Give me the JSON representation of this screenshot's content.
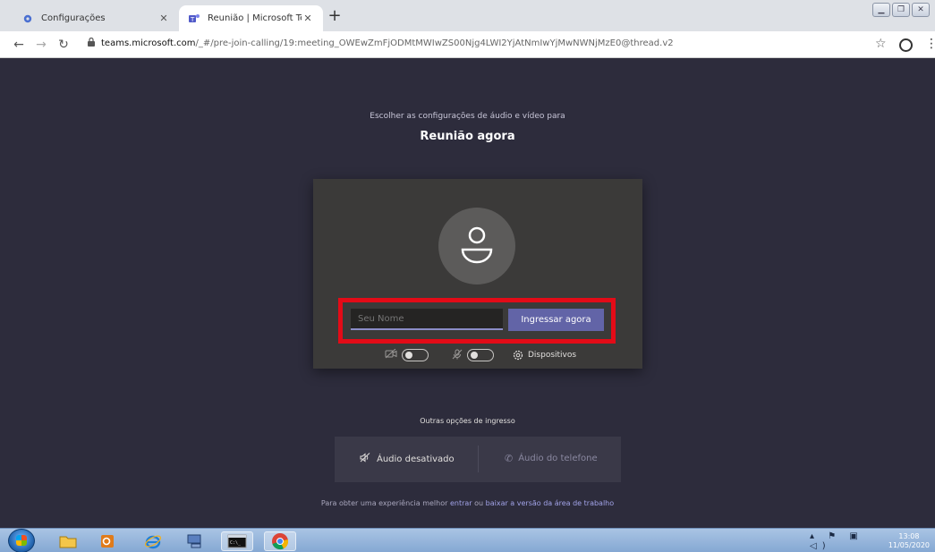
{
  "browser": {
    "tabs": [
      {
        "label": "Configurações",
        "icon": "gear-icon"
      },
      {
        "label": "Reunião | Microsoft Teams",
        "icon": "teams-icon"
      }
    ],
    "new_tab_label": "+",
    "url_domain": "teams.microsoft.com",
    "url_path": "/_#/pre-join-calling/19:meeting_OWEwZmFjODMtMWIwZS00Njg4LWI2YjAtNmIwYjMwNWNjMzE0@thread.v2"
  },
  "prejoin": {
    "subtitle": "Escolher as configurações de áudio e vídeo para",
    "title": "Reunião agora",
    "name_placeholder": "Seu Nome",
    "join_label": "Ingressar agora",
    "devices_label": "Dispositivos",
    "camera_on": false,
    "mic_on": false
  },
  "other_options": {
    "heading": "Outras opções de ingresso",
    "audio_off_label": "Áudio desativado",
    "phone_audio_label": "Áudio do telefone"
  },
  "footer": {
    "prefix": "Para obter uma experiência melhor ",
    "link1": "entrar",
    "middle": " ou ",
    "link2": "baixar a versão da área de trabalho"
  },
  "taskbar": {
    "time": "13:08",
    "date": "11/05/2020"
  },
  "colors": {
    "background": "#2d2c3c",
    "card": "#3b3a39",
    "accent": "#6264a7",
    "highlight": "#e30b17"
  }
}
